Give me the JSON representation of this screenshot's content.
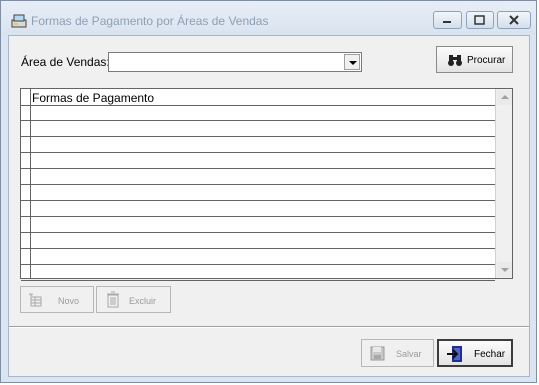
{
  "window": {
    "title": "Formas de Pagamento por Áreas de Vendas"
  },
  "form": {
    "area_label": "Área de Vendas:",
    "area_value": "",
    "search_button": "Procurar"
  },
  "grid": {
    "column_header": "Formas de Pagamento",
    "rows": [
      "",
      "",
      "",
      "",
      "",
      "",
      "",
      "",
      "",
      "",
      ""
    ]
  },
  "actions": {
    "new_button": "Novo",
    "delete_button": "Excluir",
    "save_button": "Salvar",
    "close_button": "Fechar"
  },
  "icons": {
    "app": "app-icon",
    "search": "binoculars-icon",
    "new": "new-record-icon",
    "delete": "trash-icon",
    "save": "floppy-disk-icon",
    "close": "exit-door-icon"
  }
}
